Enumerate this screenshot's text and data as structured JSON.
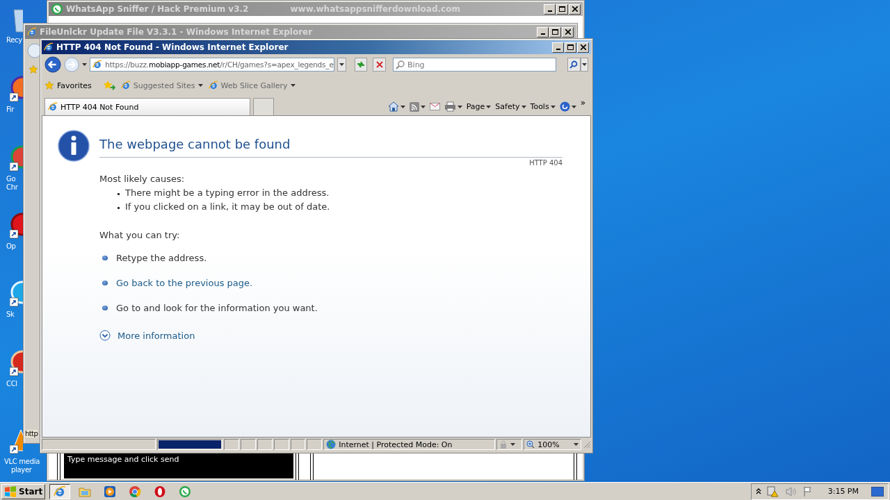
{
  "desktop": {
    "icons": [
      {
        "kind": "recycle",
        "lines": [
          "Recy"
        ]
      },
      {
        "kind": "firefox",
        "lines": [
          "Fir"
        ]
      },
      {
        "kind": "chrome",
        "lines": [
          "Go",
          "Chr"
        ]
      },
      {
        "kind": "opera",
        "lines": [
          "Op"
        ]
      },
      {
        "kind": "skype",
        "lines": [
          "Sk"
        ]
      },
      {
        "kind": "ccleaner",
        "lines": [
          "CCl"
        ]
      },
      {
        "kind": "vlc",
        "lines": [
          "VLC media",
          "player"
        ]
      }
    ]
  },
  "windows": [
    {
      "kind": "sniffer",
      "active": false,
      "title": "WhatsApp Sniffer / Hack Premium v3.2",
      "subtitle": "www.whatsappsnifferdownload.com",
      "message": "Type message and click send"
    },
    {
      "kind": "ie_back",
      "active": false,
      "title": "FileUnlckr Update File V3.3.1 - Windows Internet Explorer",
      "status": "http"
    },
    {
      "kind": "ie",
      "active": true,
      "title": "HTTP 404 Not Found - Windows Internet Explorer",
      "address": {
        "prefix": "https://buzz.",
        "domain": "mobiapp-games.net",
        "rest": "/r/CH/games?s=apex_legends_e"
      },
      "search": {
        "placeholder": "Bing"
      },
      "favorites": {
        "label": "Favorites",
        "links": [
          {
            "label": "Suggested Sites"
          },
          {
            "label": "Web Slice Gallery"
          }
        ]
      },
      "tabs": [
        {
          "label": "HTTP 404 Not Found",
          "selected": true
        }
      ],
      "commands": [
        {
          "kind": "home"
        },
        {
          "kind": "feeds"
        },
        {
          "kind": "mail"
        },
        {
          "kind": "print"
        },
        {
          "kind": "menu",
          "label": "Page"
        },
        {
          "kind": "menu",
          "label": "Safety"
        },
        {
          "kind": "menu",
          "label": "Tools"
        },
        {
          "kind": "help"
        },
        {
          "kind": "more",
          "label": "»"
        }
      ],
      "page": {
        "title": "The webpage cannot be found",
        "code": "HTTP 404",
        "causes_heading": "Most likely causes:",
        "causes": [
          "There might be a typing error in the address.",
          "If you clicked on a link, it may be out of date."
        ],
        "try_heading": "What you can try:",
        "tries": [
          {
            "kind": "text",
            "text": "Retype the address."
          },
          {
            "kind": "link",
            "text": "Go back to the previous page."
          },
          {
            "kind": "text",
            "text": "Go to  and look for the information you want."
          }
        ],
        "more": "More information"
      },
      "status_bar": {
        "progress": {
          "level": 1
        },
        "zone": "Internet | Protected Mode: On",
        "zoom": "100%"
      }
    }
  ],
  "taskbar": {
    "start": "Start",
    "apps": [
      {
        "kind": "ie",
        "selected": true
      },
      {
        "kind": "explorer",
        "selected": false
      },
      {
        "kind": "media",
        "selected": false
      },
      {
        "kind": "chrome",
        "selected": false
      },
      {
        "kind": "opera",
        "selected": false
      },
      {
        "kind": "sniffer",
        "selected": false
      }
    ],
    "clock": "3:15 PM"
  }
}
